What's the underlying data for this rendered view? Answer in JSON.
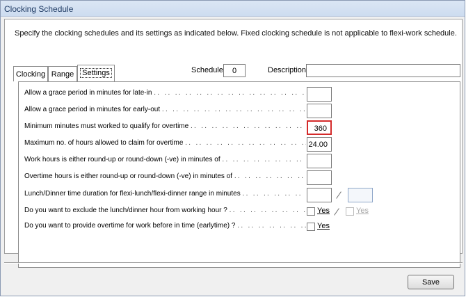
{
  "window": {
    "title": "Clocking Schedule"
  },
  "instructions": "Specify the clocking schedules and its settings as indicated below. Fixed clocking schedule is not applicable to flexi-work schedule.",
  "tabs": [
    {
      "label": "Clocking"
    },
    {
      "label": "Range"
    },
    {
      "label": "Settings"
    }
  ],
  "schedule": {
    "label": "Schedule",
    "value": "0"
  },
  "description": {
    "label": "Description",
    "value": ""
  },
  "settings": [
    {
      "label": "Allow a grace period in minutes for late-in",
      "value": ""
    },
    {
      "label": "Allow a grace period in minutes for early-out",
      "value": ""
    },
    {
      "label": "Minimum minutes must worked to qualify for overtime",
      "value": "360"
    },
    {
      "label": "Maximum no. of hours allowed to claim for overtime",
      "value": "24.00"
    },
    {
      "label": "Work hours is either round-up or round-down (-ve) in minutes of",
      "value": ""
    },
    {
      "label": "Overtime hours is either round-up or round-down (-ve) in minutes of",
      "value": ""
    },
    {
      "label": "Lunch/Dinner time duration for flexi-lunch/flexi-dinner range in minutes",
      "value": "",
      "value2": ""
    }
  ],
  "checks": [
    {
      "label": "Do you want to exclude the lunch/dinner hour from working hour ?",
      "option": "Yes",
      "option2": "Yes"
    },
    {
      "label": "Do you want to provide overtime for work before in time (earlytime) ?",
      "option": "Yes"
    }
  ],
  "leader": ".. .. .. .. .. .. .. .. .. .. .. .. .. .. .. .. .. .. .. .. .. .. .. .. .. ..",
  "buttons": {
    "save": "Save"
  }
}
